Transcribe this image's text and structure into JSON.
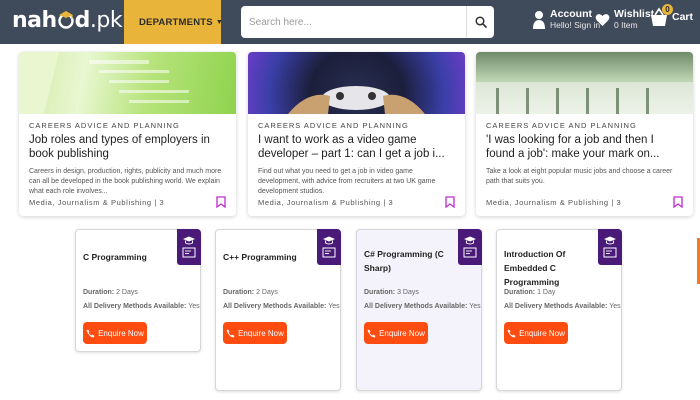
{
  "header": {
    "logo_left": "nah",
    "logo_right": "d",
    "logo_suffix": ".pk",
    "departments_label": "DEPARTMENTS",
    "search_placeholder": "Search here...",
    "account_title": "Account",
    "account_subtitle": "Hello! Sign in",
    "wishlist_title": "Wishlist",
    "wishlist_subtitle": "0 Item",
    "cart_label": "Cart",
    "cart_count": "0",
    "colors": {
      "bar": "#3f4a5a",
      "accent": "#e8b53a"
    }
  },
  "blog_cards": [
    {
      "image": "books-photo",
      "category": "CAREERS ADVICE AND PLANNING",
      "title": "Job roles and types of employers in book publishing",
      "excerpt": "Careers in design, production, rights, publicity and much more can all be developed in the book publishing world. We explain what each role involves...",
      "meta": "Media, Journalism & Publishing | 3"
    },
    {
      "image": "gaming-controller-photo",
      "category": "CAREERS ADVICE AND PLANNING",
      "title": "I want to work as a video game developer – part 1: can I get a job i...",
      "excerpt": "Find out what you need to get a job in video game development, with advice from recruiters at two UK game development studios.",
      "meta": "Media, Journalism & Publishing | 3"
    },
    {
      "image": "music-photo",
      "category": "CAREERS ADVICE AND PLANNING",
      "title": "'I was looking for a job and then I found a job': make your mark on...",
      "excerpt": "Take a look at eight popular music jobs and choose a career path that suits you.",
      "meta": "Media, Journalism & Publishing | 3"
    }
  ],
  "courses": [
    {
      "title": "C Programming",
      "duration_label": "Duration:",
      "duration": "2 Days",
      "delivery_label": "All Delivery Methods Available:",
      "delivery": "Yes",
      "button": "Enquire Now"
    },
    {
      "title": "C++ Programming",
      "duration_label": "Duration:",
      "duration": "2 Days",
      "delivery_label": "All Delivery Methods Available:",
      "delivery": "Yes",
      "button": "Enquire Now"
    },
    {
      "title": "C# Programming (C Sharp)",
      "duration_label": "Duration:",
      "duration": "3 Days",
      "delivery_label": "All Delivery Methods Available:",
      "delivery": "Yes",
      "button": "Enquire Now"
    },
    {
      "title": "Introduction Of Embedded C Programming",
      "duration_label": "Duration:",
      "duration": "1 Day",
      "delivery_label": "All Delivery Methods Available:",
      "delivery": "Yes",
      "button": "Enquire Now"
    }
  ],
  "colors": {
    "enquire": "#ff4d12",
    "course_badge": "#4a1a78",
    "bookmark": "#c02bd1"
  }
}
